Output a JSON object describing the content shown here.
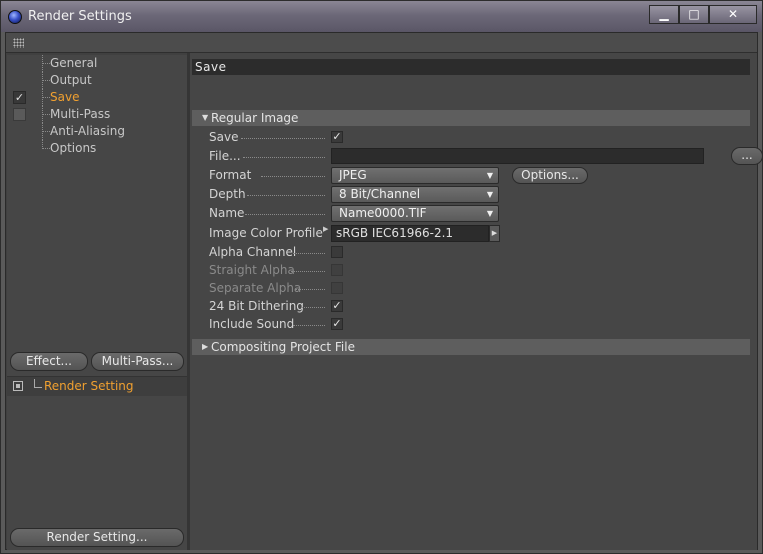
{
  "window": {
    "title": "Render Settings",
    "minimize_symbol": "▁",
    "maximize_symbol": "□",
    "close_symbol": "✕"
  },
  "sidebar": {
    "items": [
      {
        "label": "General",
        "active": false,
        "check": ""
      },
      {
        "label": "Output",
        "active": false,
        "check": ""
      },
      {
        "label": "Save",
        "active": true,
        "check": "✓"
      },
      {
        "label": "Multi-Pass",
        "active": false,
        "check": "box"
      },
      {
        "label": "Anti-Aliasing",
        "active": false,
        "check": ""
      },
      {
        "label": "Options",
        "active": false,
        "check": ""
      }
    ],
    "effect_button": "Effect...",
    "multipass_button": "Multi-Pass...",
    "render_setting_item": "Render Setting",
    "render_setting_button": "Render Setting..."
  },
  "main": {
    "page_title": "Save",
    "regular_image": {
      "header": "Regular Image",
      "save_label": "Save",
      "save_checked": "✓",
      "file_label": "File...",
      "file_value": "",
      "browse_label": "...",
      "format_label": "Format",
      "format_value": "JPEG",
      "options_button": "Options...",
      "depth_label": "Depth",
      "depth_value": "8 Bit/Channel",
      "name_label": "Name",
      "name_value": "Name0000.TIF",
      "profile_label": "Image Color Profile",
      "profile_value": "sRGB IEC61966-2.1",
      "alpha_channel_label": "Alpha Channel",
      "alpha_channel_checked": "",
      "straight_alpha_label": "Straight Alpha",
      "straight_alpha_checked": "",
      "separate_alpha_label": "Separate Alpha",
      "separate_alpha_checked": "",
      "dithering_label": "24 Bit Dithering",
      "dithering_checked": "✓",
      "sound_label": "Include Sound",
      "sound_checked": "✓"
    },
    "compositing_header": "Compositing Project File"
  },
  "colors": {
    "accent_active": "#f0a030",
    "panel_bg": "#464646",
    "title_bar": "#6c6878"
  }
}
